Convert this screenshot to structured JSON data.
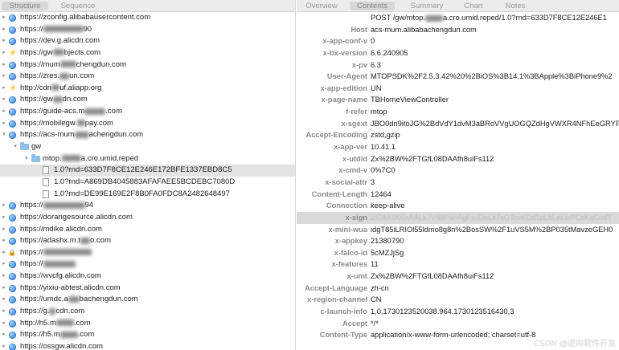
{
  "left_tabs": [
    "Structure",
    "Sequence"
  ],
  "right_tabs": [
    "Overview",
    "Contents",
    "Summary",
    "Chart",
    "Notes"
  ],
  "tree": [
    {
      "indent": 0,
      "disc": "▸",
      "icon": "globe",
      "label": "https://zconfig.alibabausercontent.com"
    },
    {
      "indent": 0,
      "disc": "▸",
      "icon": "globe",
      "label": "https://",
      "blur": 50,
      "after": "90"
    },
    {
      "indent": 0,
      "disc": "▸",
      "icon": "globe",
      "label": "https://dev.g.alicdn.com"
    },
    {
      "indent": 0,
      "disc": "▸",
      "icon": "bolt",
      "label": "https://gw",
      "blur": 14,
      "after": "bjects.com"
    },
    {
      "indent": 0,
      "disc": "▸",
      "icon": "globe",
      "label": "https://mum",
      "blur": 20,
      "after": "chengdun.com"
    },
    {
      "indent": 0,
      "disc": "▸",
      "icon": "globe",
      "label": "https://zres.",
      "blur": 12,
      "after": "un.com"
    },
    {
      "indent": 0,
      "disc": "▸",
      "icon": "bolt",
      "label": "http://cdn",
      "blur": 10,
      "after": "uf.aliapp.org"
    },
    {
      "indent": 0,
      "disc": "▸",
      "icon": "globe",
      "label": "https://gw",
      "blur": 12,
      "after": "dn.com"
    },
    {
      "indent": 0,
      "disc": "▸",
      "icon": "globe",
      "label": "https://guide-acs.m",
      "blur": 26,
      "after": ".com"
    },
    {
      "indent": 0,
      "disc": "▸",
      "icon": "globe",
      "label": "https://mobilegw.",
      "blur": 10,
      "after": "pay.com"
    },
    {
      "indent": 0,
      "disc": "▾",
      "icon": "globe",
      "label": "https://acs-mum",
      "blur": 18,
      "after": "achengdun.com"
    },
    {
      "indent": 1,
      "disc": "▾",
      "icon": "folder",
      "label": "gw"
    },
    {
      "indent": 2,
      "disc": "▾",
      "icon": "folder",
      "label": "mtop.",
      "blur": 24,
      "after": "a.cro.umid.reped"
    },
    {
      "indent": 3,
      "disc": "",
      "icon": "doc",
      "label": "1.0?rnd=633D7F8CE12E246E172BFE1337EBD8C5",
      "selected": true
    },
    {
      "indent": 3,
      "disc": "",
      "icon": "doc",
      "label": "1.0?rnd=A869DB4045883AFAFAEE5BCDEBC7080D"
    },
    {
      "indent": 3,
      "disc": "",
      "icon": "doc",
      "label": "1.0?rnd=DE99E169E2F8B0FA0FDC8A2482648497"
    },
    {
      "indent": 0,
      "disc": "▸",
      "icon": "globe",
      "label": "https://",
      "blur": 52,
      "after": "94"
    },
    {
      "indent": 0,
      "disc": "▸",
      "icon": "globe",
      "label": "https://dorangesource.alicdn.com"
    },
    {
      "indent": 0,
      "disc": "▸",
      "icon": "globe",
      "label": "https://mdike.alicdn.com"
    },
    {
      "indent": 0,
      "disc": "▸",
      "icon": "globe",
      "label": "https://adashx.m.t",
      "blur": 12,
      "after": "o.com"
    },
    {
      "indent": 0,
      "disc": "▸",
      "icon": "lock",
      "label": "https://",
      "blur": 60,
      "after": ""
    },
    {
      "indent": 0,
      "disc": "▸",
      "icon": "globe",
      "label": "https://",
      "blur": 40,
      "after": ""
    },
    {
      "indent": 0,
      "disc": "▸",
      "icon": "globe",
      "label": "https://wvcfg.alicdn.com"
    },
    {
      "indent": 0,
      "disc": "▸",
      "icon": "globe",
      "label": "https://yixiu-abtest.alicdn.com"
    },
    {
      "indent": 0,
      "disc": "▸",
      "icon": "globe",
      "label": "https://umdc.a",
      "blur": 14,
      "after": "bachengdun.com"
    },
    {
      "indent": 0,
      "disc": "▸",
      "icon": "globe",
      "label": "https://g.",
      "blur": 8,
      "after": "cdn.com"
    },
    {
      "indent": 0,
      "disc": "▸",
      "icon": "globe",
      "label": "http://h5.m",
      "blur": 22,
      "after": ".com"
    },
    {
      "indent": 0,
      "disc": "▸",
      "icon": "globe",
      "label": "https://h5.m",
      "blur": 22,
      "after": ".com"
    },
    {
      "indent": 0,
      "disc": "▸",
      "icon": "globe",
      "label": "https://ossgw.alicdn.com"
    }
  ],
  "headers": [
    {
      "k": "",
      "v": "POST /gw/mtop.",
      "blur": 22,
      "after": "a.cro.umid.reped/1.0?rnd=633D7F8CE12E246E1"
    },
    {
      "k": "Host",
      "v": "acs-mum.alibabachengdun.com"
    },
    {
      "k": "x-app-conf-v",
      "v": "0"
    },
    {
      "k": "x-bx-version",
      "v": "6.6.240905"
    },
    {
      "k": "x-pv",
      "v": "6.3"
    },
    {
      "k": "User-Agent",
      "v": "MTOPSDK%2F2.5.3.42%20%2BiOS%3B14.1%3BApple%3BiPhone9%2"
    },
    {
      "k": "x-app-edition",
      "v": "UN"
    },
    {
      "k": "x-page-name",
      "v": "TBHomeViewController"
    },
    {
      "k": "f-refer",
      "v": "mtop"
    },
    {
      "k": "x-sgext",
      "v": "JBO0dn9itoJG%2BdVdY1dvM3aBRoVVgUOGQZdHgVWXR4NFhEeGRYP"
    },
    {
      "k": "Accept-Encoding",
      "v": "zstd,gzip"
    },
    {
      "k": "x-app-ver",
      "v": "10.41.1"
    },
    {
      "k": "x-utdid",
      "v": "Zx%2BW%2FTGfL08DAAfh8uiFs112"
    },
    {
      "k": "x-cmd-v",
      "v": "0%7C0"
    },
    {
      "k": "x-social-attr",
      "v": "3"
    },
    {
      "k": "Content-Length",
      "v": "12464"
    },
    {
      "k": "Connection",
      "v": "keep-alive"
    },
    {
      "k": "x-sign",
      "v": "izGIkK005xAALk7Vd8PanAgFxxDeLk7sOTcvKDd1pLhLecxrPCsKqCodT",
      "highlight": true
    },
    {
      "k": "x-mini-wua",
      "v": "idgT85iLRIOl55ldmo8g8n%2BosSW%2F1uVS5M%2BP035tMavzeGEH0"
    },
    {
      "k": "x-appkey",
      "v": "21380790"
    },
    {
      "k": "x-falco-id",
      "v": "5cMZJjSg"
    },
    {
      "k": "x-features",
      "v": "11"
    },
    {
      "k": "x-umt",
      "v": "Zx%2BW%2FTGfL08DAAfh8uiFs112"
    },
    {
      "k": "Accept-Language",
      "v": "zh-cn"
    },
    {
      "k": "x-region-channel",
      "v": "CN"
    },
    {
      "k": "c-launch-info",
      "v": "1,0,1730123520038.964,1730123516430,3"
    },
    {
      "k": "Accept",
      "v": "*/*"
    },
    {
      "k": "Content-Type",
      "v": "application/x-www-form-urlencoded; charset=utf-8"
    },
    {
      "k": "",
      "v": ""
    }
  ],
  "watermark": "CSDN @逆向软件开发"
}
